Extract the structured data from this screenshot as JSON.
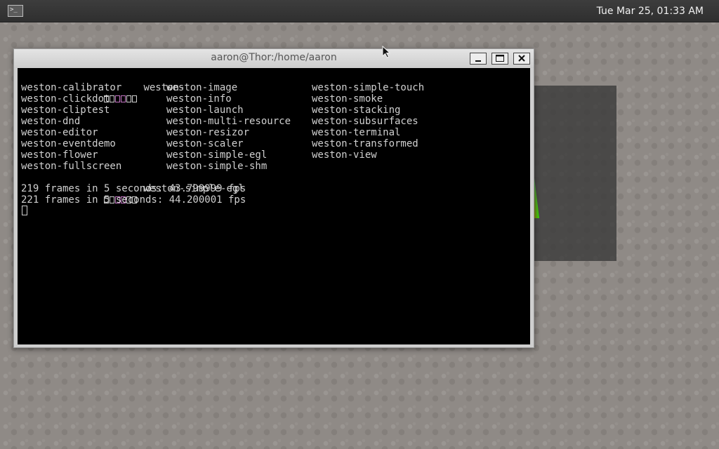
{
  "panel": {
    "launcher_icon": "terminal-launcher-icon",
    "launcher_glyph": ">_",
    "clock": "Tue Mar 25, 01:33 AM"
  },
  "window": {
    "title": "aaron@Thor:/home/aaron",
    "buttons": [
      "minimize",
      "maximize",
      "close"
    ]
  },
  "terminal": {
    "prompt_glyph_count": 6,
    "command1": "weston-",
    "completions": [
      [
        "weston-calibrator",
        "weston-image",
        "weston-simple-touch"
      ],
      [
        "weston-clickdot",
        "weston-info",
        "weston-smoke"
      ],
      [
        "weston-cliptest",
        "weston-launch",
        "weston-stacking"
      ],
      [
        "weston-dnd",
        "weston-multi-resource",
        "weston-subsurfaces"
      ],
      [
        "weston-editor",
        "weston-resizor",
        "weston-terminal"
      ],
      [
        "weston-eventdemo",
        "weston-scaler",
        "weston-transformed"
      ],
      [
        "weston-flower",
        "weston-simple-egl",
        "weston-view"
      ],
      [
        "weston-fullscreen",
        "weston-simple-shm",
        ""
      ]
    ],
    "command2": "weston-simple-egl",
    "output": [
      "219 frames in 5 seconds: 43.799999 fps",
      "221 frames in 5 seconds: 44.200001 fps"
    ]
  },
  "colors": {
    "panel_bg": "#353535",
    "terminal_bg": "#000000",
    "terminal_fg": "#d0d0d0",
    "prompt_accent": "#c678c6"
  }
}
